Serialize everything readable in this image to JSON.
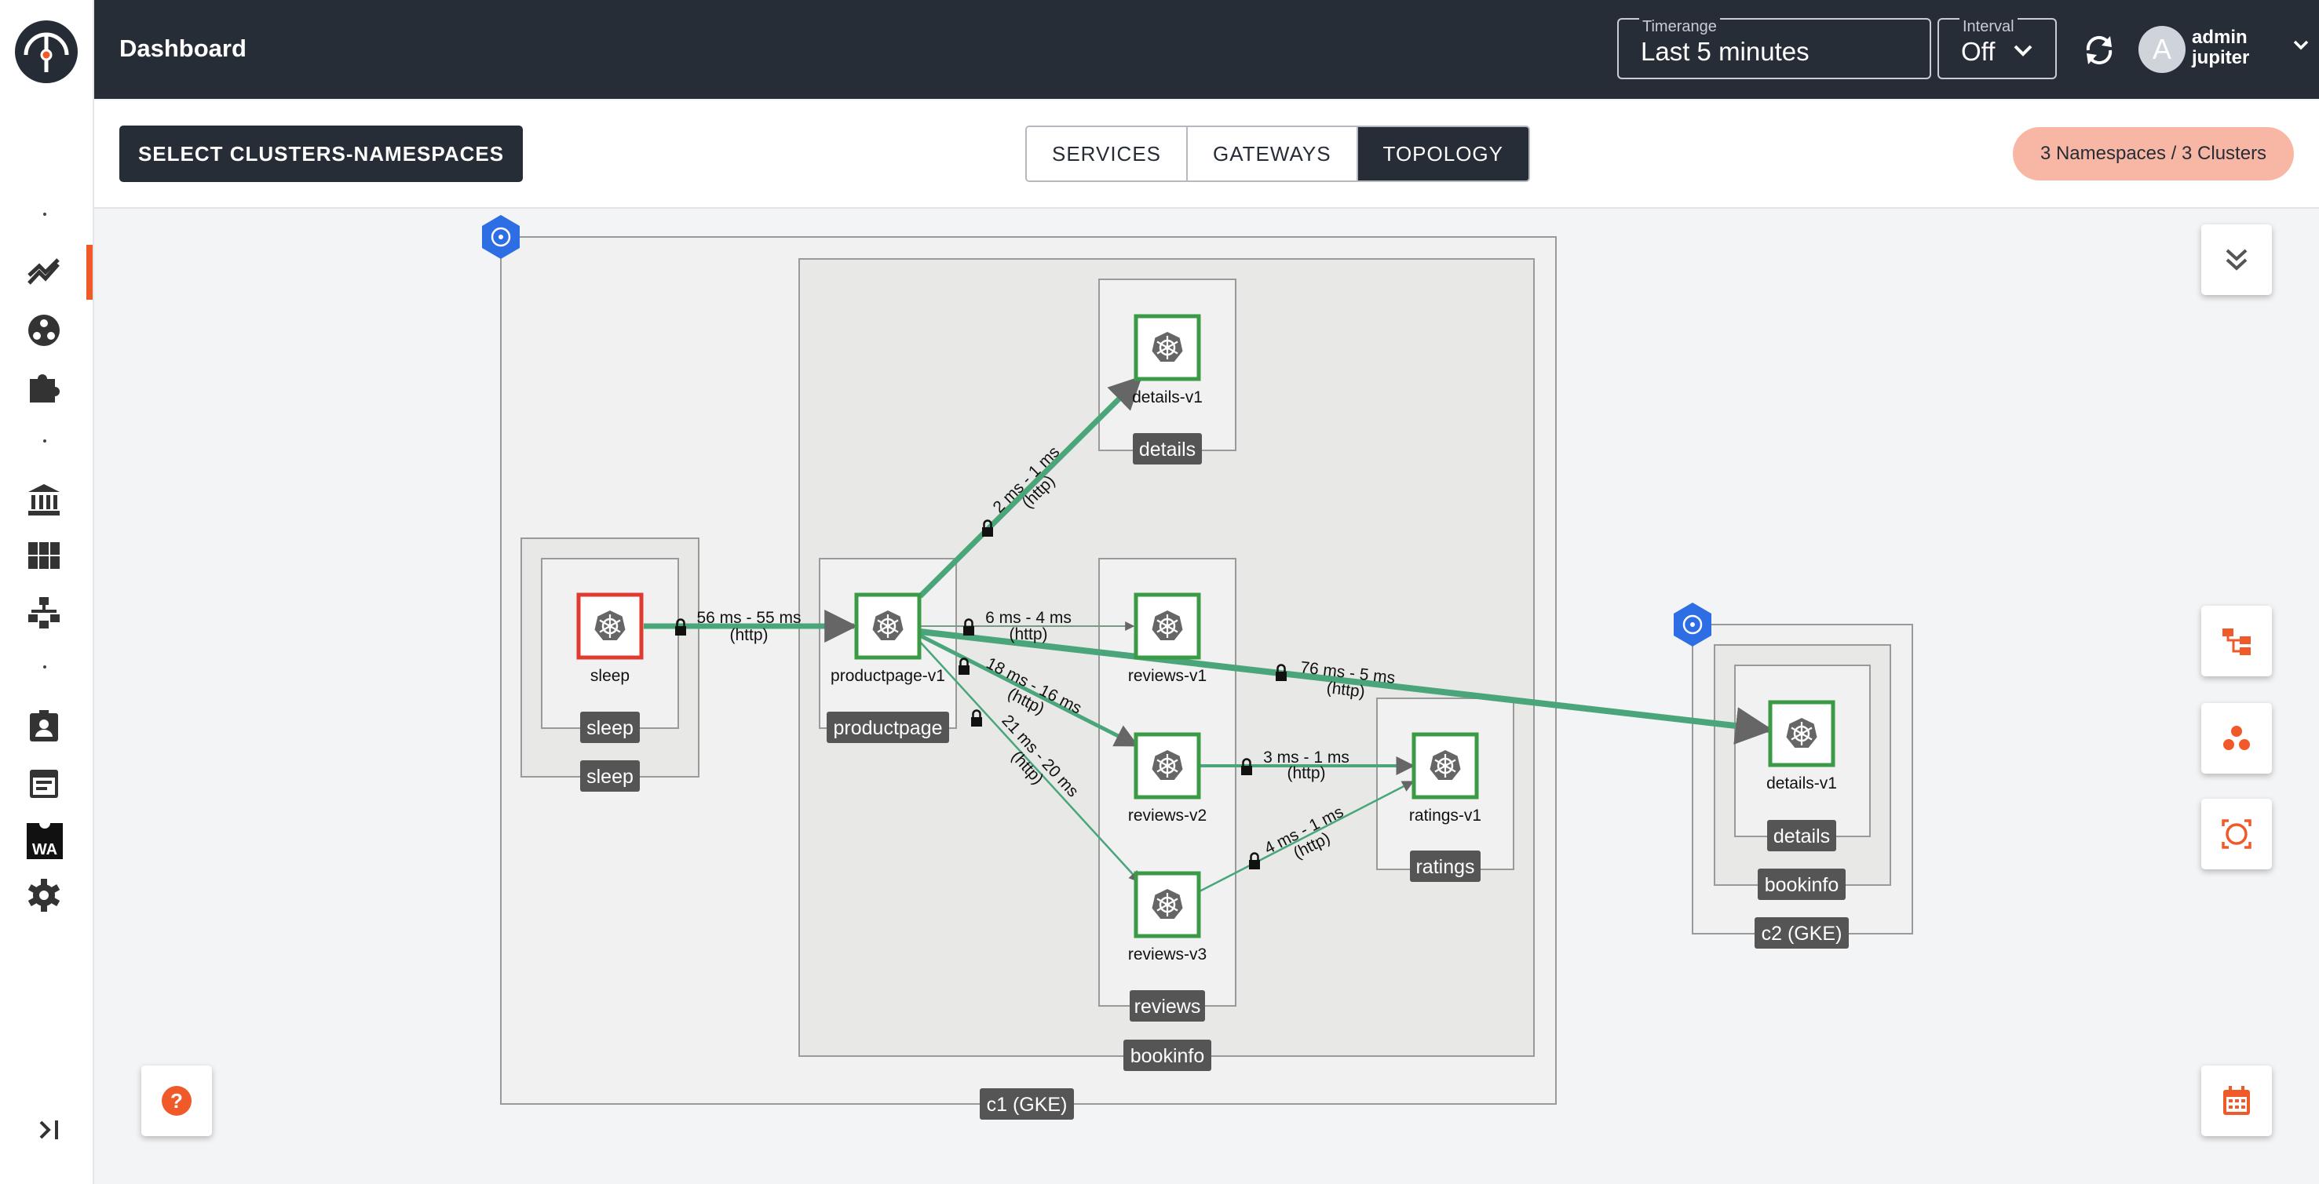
{
  "app": {
    "title": "Dashboard"
  },
  "header": {
    "timerange": {
      "label": "Timerange",
      "value": "Last 5 minutes"
    },
    "interval": {
      "label": "Interval",
      "value": "Off"
    },
    "user": {
      "avatar_letter": "A",
      "name": "admin",
      "org": "jupiter"
    }
  },
  "toolbar": {
    "select_button": "SELECT CLUSTERS-NAMESPACES",
    "tabs": [
      {
        "label": "SERVICES",
        "active": false
      },
      {
        "label": "GATEWAYS",
        "active": false
      },
      {
        "label": "TOPOLOGY",
        "active": true
      }
    ],
    "namespace_badge": "3 Namespaces / 3 Clusters"
  },
  "sidebar": {
    "items": [
      {
        "icon": "overview-chart-icon",
        "active": true
      },
      {
        "icon": "mesh-icon",
        "active": false
      },
      {
        "icon": "puzzle-icon",
        "active": false
      },
      {
        "icon": "bank-icon",
        "active": false
      },
      {
        "icon": "grid-icon",
        "active": false
      },
      {
        "icon": "hierarchy-icon",
        "active": false
      },
      {
        "icon": "badge-icon",
        "active": false
      },
      {
        "icon": "calendar-icon",
        "active": false
      },
      {
        "icon": "wasm-icon",
        "label": "WA",
        "active": false
      },
      {
        "icon": "gear-icon",
        "active": false
      }
    ]
  },
  "colors": {
    "accent": "#f05a28",
    "header_bg": "#272d37",
    "healthy": "#3a9a45",
    "error": "#e03b31",
    "edge": "#4aa67a",
    "cluster_badge": "#2e6ee4"
  },
  "graph": {
    "clusters": [
      {
        "label": "c1 (GKE)"
      },
      {
        "label": "c2 (GKE)"
      }
    ],
    "namespaces": [
      {
        "label": "sleep"
      },
      {
        "label": "bookinfo"
      },
      {
        "label": "bookinfo"
      }
    ],
    "services": [
      {
        "label": "sleep"
      },
      {
        "label": "productpage"
      },
      {
        "label": "details"
      },
      {
        "label": "reviews"
      },
      {
        "label": "ratings"
      },
      {
        "label": "details"
      }
    ],
    "workloads": [
      {
        "label": "sleep",
        "status": "error"
      },
      {
        "label": "productpage-v1",
        "status": "healthy"
      },
      {
        "label": "details-v1",
        "status": "healthy"
      },
      {
        "label": "reviews-v1",
        "status": "healthy"
      },
      {
        "label": "reviews-v2",
        "status": "healthy"
      },
      {
        "label": "reviews-v3",
        "status": "healthy"
      },
      {
        "label": "ratings-v1",
        "status": "healthy"
      },
      {
        "label": "details-v1",
        "status": "healthy"
      }
    ],
    "edges": [
      {
        "from": "sleep",
        "to": "productpage-v1",
        "latency": "56 ms - 55 ms",
        "protocol": "(http)"
      },
      {
        "from": "productpage-v1",
        "to": "details-v1",
        "latency": "2 ms - 1 ms",
        "protocol": "(http)"
      },
      {
        "from": "productpage-v1",
        "to": "reviews-v1",
        "latency": "6 ms - 4 ms",
        "protocol": "(http)"
      },
      {
        "from": "productpage-v1",
        "to": "details-v1 (c2)",
        "latency": "76 ms - 5 ms",
        "protocol": "(http)"
      },
      {
        "from": "productpage-v1",
        "to": "reviews-v2",
        "latency": "18 ms - 16 ms",
        "protocol": "(http)"
      },
      {
        "from": "productpage-v1",
        "to": "reviews-v3",
        "latency": "21 ms - 20 ms",
        "protocol": "(http)"
      },
      {
        "from": "reviews-v2",
        "to": "ratings-v1",
        "latency": "3 ms - 1 ms",
        "protocol": "(http)"
      },
      {
        "from": "reviews-v3",
        "to": "ratings-v1",
        "latency": "4 ms - 1 ms",
        "protocol": "(http)"
      }
    ]
  },
  "floating_buttons": [
    {
      "icon": "collapse-double-chevron-icon"
    },
    {
      "icon": "layout-tree-icon"
    },
    {
      "icon": "cluster-view-icon"
    },
    {
      "icon": "focus-icon"
    },
    {
      "icon": "calendar-icon"
    },
    {
      "icon": "help-icon"
    }
  ]
}
